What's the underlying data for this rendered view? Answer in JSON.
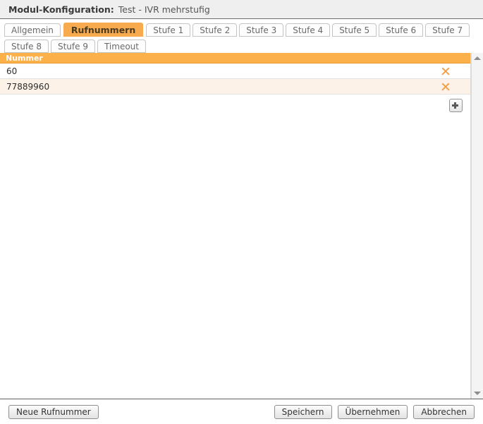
{
  "titlebar": {
    "label": "Modul-Konfiguration:",
    "value": "Test - IVR mehrstufig"
  },
  "tabs": {
    "row1": [
      {
        "label": "Allgemein",
        "active": false
      },
      {
        "label": "Rufnummern",
        "active": true
      },
      {
        "label": "Stufe 1",
        "active": false
      },
      {
        "label": "Stufe 2",
        "active": false
      },
      {
        "label": "Stufe 3",
        "active": false
      },
      {
        "label": "Stufe 4",
        "active": false
      },
      {
        "label": "Stufe 5",
        "active": false
      },
      {
        "label": "Stufe 6",
        "active": false
      },
      {
        "label": "Stufe 7",
        "active": false
      }
    ],
    "row2": [
      {
        "label": "Stufe 8",
        "active": false
      },
      {
        "label": "Stufe 9",
        "active": false
      },
      {
        "label": "Timeout",
        "active": false
      }
    ]
  },
  "grid": {
    "columns": [
      "Nummer"
    ],
    "rows": [
      {
        "nummer": "60"
      },
      {
        "nummer": "77889960"
      }
    ],
    "add_icon": "plus-icon",
    "delete_icon": "close-x-icon"
  },
  "scrollbar": {
    "up_icon": "arrow-up-icon",
    "down_icon": "arrow-down-icon"
  },
  "footer": {
    "new_number": "Neue Rufnummer",
    "save": "Speichern",
    "apply": "Übernehmen",
    "cancel": "Abbrechen"
  },
  "colors": {
    "accent_orange": "#f8aa4f",
    "header_orange": "#fcb04a",
    "row_alt": "#fcf2e8",
    "titlebar_bg": "#efefef"
  }
}
